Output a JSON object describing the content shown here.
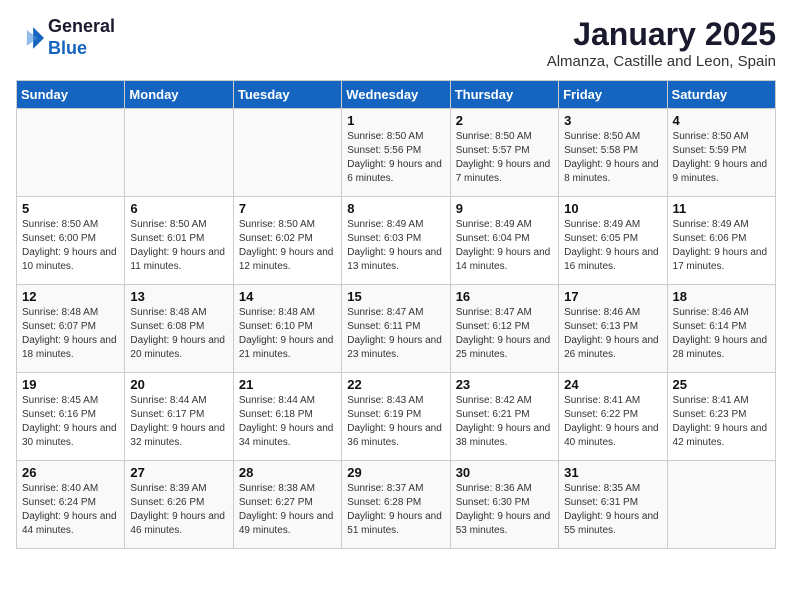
{
  "logo": {
    "general": "General",
    "blue": "Blue"
  },
  "title": "January 2025",
  "location": "Almanza, Castille and Leon, Spain",
  "weekdays": [
    "Sunday",
    "Monday",
    "Tuesday",
    "Wednesday",
    "Thursday",
    "Friday",
    "Saturday"
  ],
  "weeks": [
    [
      {
        "day": "",
        "info": ""
      },
      {
        "day": "",
        "info": ""
      },
      {
        "day": "",
        "info": ""
      },
      {
        "day": "1",
        "info": "Sunrise: 8:50 AM\nSunset: 5:56 PM\nDaylight: 9 hours and 6 minutes."
      },
      {
        "day": "2",
        "info": "Sunrise: 8:50 AM\nSunset: 5:57 PM\nDaylight: 9 hours and 7 minutes."
      },
      {
        "day": "3",
        "info": "Sunrise: 8:50 AM\nSunset: 5:58 PM\nDaylight: 9 hours and 8 minutes."
      },
      {
        "day": "4",
        "info": "Sunrise: 8:50 AM\nSunset: 5:59 PM\nDaylight: 9 hours and 9 minutes."
      }
    ],
    [
      {
        "day": "5",
        "info": "Sunrise: 8:50 AM\nSunset: 6:00 PM\nDaylight: 9 hours and 10 minutes."
      },
      {
        "day": "6",
        "info": "Sunrise: 8:50 AM\nSunset: 6:01 PM\nDaylight: 9 hours and 11 minutes."
      },
      {
        "day": "7",
        "info": "Sunrise: 8:50 AM\nSunset: 6:02 PM\nDaylight: 9 hours and 12 minutes."
      },
      {
        "day": "8",
        "info": "Sunrise: 8:49 AM\nSunset: 6:03 PM\nDaylight: 9 hours and 13 minutes."
      },
      {
        "day": "9",
        "info": "Sunrise: 8:49 AM\nSunset: 6:04 PM\nDaylight: 9 hours and 14 minutes."
      },
      {
        "day": "10",
        "info": "Sunrise: 8:49 AM\nSunset: 6:05 PM\nDaylight: 9 hours and 16 minutes."
      },
      {
        "day": "11",
        "info": "Sunrise: 8:49 AM\nSunset: 6:06 PM\nDaylight: 9 hours and 17 minutes."
      }
    ],
    [
      {
        "day": "12",
        "info": "Sunrise: 8:48 AM\nSunset: 6:07 PM\nDaylight: 9 hours and 18 minutes."
      },
      {
        "day": "13",
        "info": "Sunrise: 8:48 AM\nSunset: 6:08 PM\nDaylight: 9 hours and 20 minutes."
      },
      {
        "day": "14",
        "info": "Sunrise: 8:48 AM\nSunset: 6:10 PM\nDaylight: 9 hours and 21 minutes."
      },
      {
        "day": "15",
        "info": "Sunrise: 8:47 AM\nSunset: 6:11 PM\nDaylight: 9 hours and 23 minutes."
      },
      {
        "day": "16",
        "info": "Sunrise: 8:47 AM\nSunset: 6:12 PM\nDaylight: 9 hours and 25 minutes."
      },
      {
        "day": "17",
        "info": "Sunrise: 8:46 AM\nSunset: 6:13 PM\nDaylight: 9 hours and 26 minutes."
      },
      {
        "day": "18",
        "info": "Sunrise: 8:46 AM\nSunset: 6:14 PM\nDaylight: 9 hours and 28 minutes."
      }
    ],
    [
      {
        "day": "19",
        "info": "Sunrise: 8:45 AM\nSunset: 6:16 PM\nDaylight: 9 hours and 30 minutes."
      },
      {
        "day": "20",
        "info": "Sunrise: 8:44 AM\nSunset: 6:17 PM\nDaylight: 9 hours and 32 minutes."
      },
      {
        "day": "21",
        "info": "Sunrise: 8:44 AM\nSunset: 6:18 PM\nDaylight: 9 hours and 34 minutes."
      },
      {
        "day": "22",
        "info": "Sunrise: 8:43 AM\nSunset: 6:19 PM\nDaylight: 9 hours and 36 minutes."
      },
      {
        "day": "23",
        "info": "Sunrise: 8:42 AM\nSunset: 6:21 PM\nDaylight: 9 hours and 38 minutes."
      },
      {
        "day": "24",
        "info": "Sunrise: 8:41 AM\nSunset: 6:22 PM\nDaylight: 9 hours and 40 minutes."
      },
      {
        "day": "25",
        "info": "Sunrise: 8:41 AM\nSunset: 6:23 PM\nDaylight: 9 hours and 42 minutes."
      }
    ],
    [
      {
        "day": "26",
        "info": "Sunrise: 8:40 AM\nSunset: 6:24 PM\nDaylight: 9 hours and 44 minutes."
      },
      {
        "day": "27",
        "info": "Sunrise: 8:39 AM\nSunset: 6:26 PM\nDaylight: 9 hours and 46 minutes."
      },
      {
        "day": "28",
        "info": "Sunrise: 8:38 AM\nSunset: 6:27 PM\nDaylight: 9 hours and 49 minutes."
      },
      {
        "day": "29",
        "info": "Sunrise: 8:37 AM\nSunset: 6:28 PM\nDaylight: 9 hours and 51 minutes."
      },
      {
        "day": "30",
        "info": "Sunrise: 8:36 AM\nSunset: 6:30 PM\nDaylight: 9 hours and 53 minutes."
      },
      {
        "day": "31",
        "info": "Sunrise: 8:35 AM\nSunset: 6:31 PM\nDaylight: 9 hours and 55 minutes."
      },
      {
        "day": "",
        "info": ""
      }
    ]
  ]
}
